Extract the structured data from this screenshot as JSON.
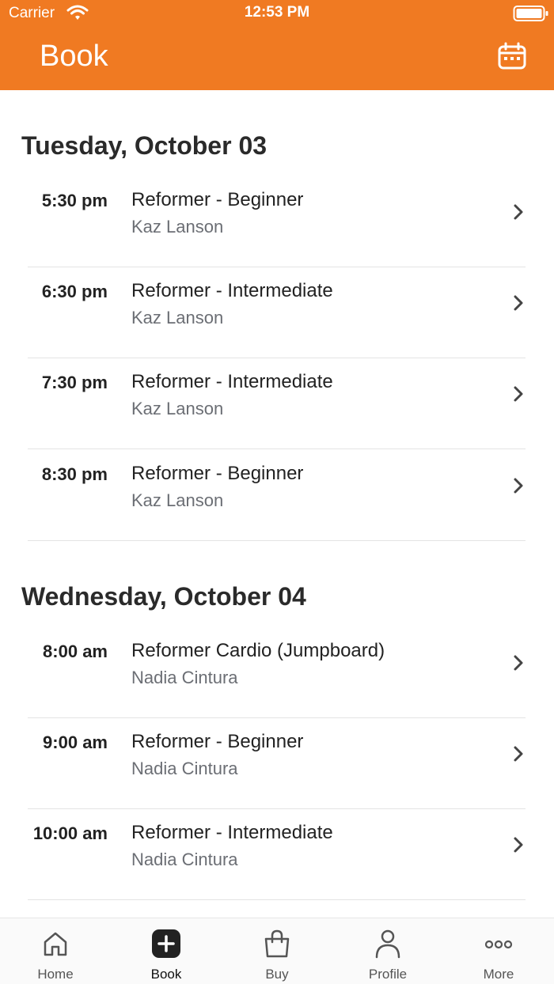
{
  "status_bar": {
    "carrier": "Carrier",
    "time": "12:53 PM"
  },
  "header": {
    "title": "Book",
    "calendar_icon": "calendar-icon"
  },
  "colors": {
    "accent": "#F07A22",
    "secondary_text": "#6b6e74",
    "divider": "#e3e3e3"
  },
  "days": [
    {
      "heading": "Tuesday, October 03",
      "classes": [
        {
          "time": "5:30 pm",
          "name": "Reformer - Beginner",
          "instructor": "Kaz Lanson"
        },
        {
          "time": "6:30 pm",
          "name": "Reformer - Intermediate",
          "instructor": "Kaz Lanson"
        },
        {
          "time": "7:30 pm",
          "name": "Reformer - Intermediate",
          "instructor": "Kaz Lanson"
        },
        {
          "time": "8:30 pm",
          "name": "Reformer - Beginner",
          "instructor": "Kaz Lanson"
        }
      ]
    },
    {
      "heading": "Wednesday, October 04",
      "classes": [
        {
          "time": "8:00 am",
          "name": "Reformer Cardio (Jumpboard)",
          "instructor": "Nadia Cintura"
        },
        {
          "time": "9:00 am",
          "name": "Reformer - Beginner",
          "instructor": "Nadia Cintura"
        },
        {
          "time": "10:00 am",
          "name": "Reformer - Intermediate",
          "instructor": "Nadia Cintura"
        }
      ]
    }
  ],
  "tabbar": {
    "active": "Book",
    "tabs": [
      {
        "label": "Home",
        "icon": "home-icon"
      },
      {
        "label": "Book",
        "icon": "plus-square-icon"
      },
      {
        "label": "Buy",
        "icon": "shopping-bag-icon"
      },
      {
        "label": "Profile",
        "icon": "person-icon"
      },
      {
        "label": "More",
        "icon": "more-dots-icon"
      }
    ]
  }
}
